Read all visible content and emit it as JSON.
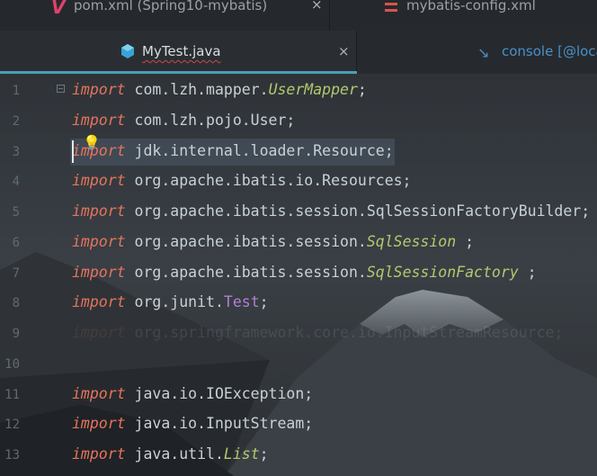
{
  "tabs_row1": [
    {
      "label": "pom.xml (Spring10-mybatis)",
      "icon": "maven-icon",
      "close": "×"
    },
    {
      "label": "mybatis-config.xml",
      "icon": "xml-file-icon",
      "close": ""
    }
  ],
  "tabs_row2": [
    {
      "label": "MyTest.java",
      "icon": "java-class-icon",
      "close": "×",
      "active": true
    },
    {
      "label": "console [@loca",
      "icon": "console-icon"
    }
  ],
  "line_numbers": [
    "1",
    "2",
    "3",
    "4",
    "5",
    "6",
    "7",
    "8",
    "9",
    "10",
    "11",
    "12",
    "13"
  ],
  "code": {
    "l1": {
      "kw": "import",
      "a": " com.lzh.mapper.",
      "b": "UserMapper",
      "c": ";"
    },
    "l2": {
      "kw": "import",
      "a": " com.lzh.pojo.User;"
    },
    "l3": {
      "kw": "import",
      "a": " jdk.internal.loader.Resource;"
    },
    "l4": {
      "kw": "import",
      "a": " org.apache.ibatis.io.Resources;"
    },
    "l5": {
      "kw": "import",
      "a": " org.apache.ibatis.session.SqlSessionFactoryBuilder;"
    },
    "l6": {
      "kw": "import",
      "a": " org.apache.ibatis.session.",
      "b": "SqlSession",
      "c": " ;"
    },
    "l7": {
      "kw": "import",
      "a": " org.apache.ibatis.session.",
      "b": "SqlSessionFactory",
      "c": " ;"
    },
    "l8": {
      "kw": "import",
      "a": " org.junit.",
      "b": "Test",
      "c": ";"
    },
    "l9": {
      "kw": "import",
      "a": " org.springframework.core.io.InputStreamResource;"
    },
    "l11": {
      "kw": "import",
      "a": " java.io.IOException;"
    },
    "l12": {
      "kw": "import",
      "a": " java.io.InputStream;"
    },
    "l13": {
      "kw": "import",
      "a": " java.util.",
      "b": "List",
      "c": ";"
    }
  },
  "colors": {
    "keyword": "#e5735a",
    "italic_type": "#b3c86e",
    "annotation": "#b07fd6",
    "active_tab_bar": "#4a9fb8"
  }
}
